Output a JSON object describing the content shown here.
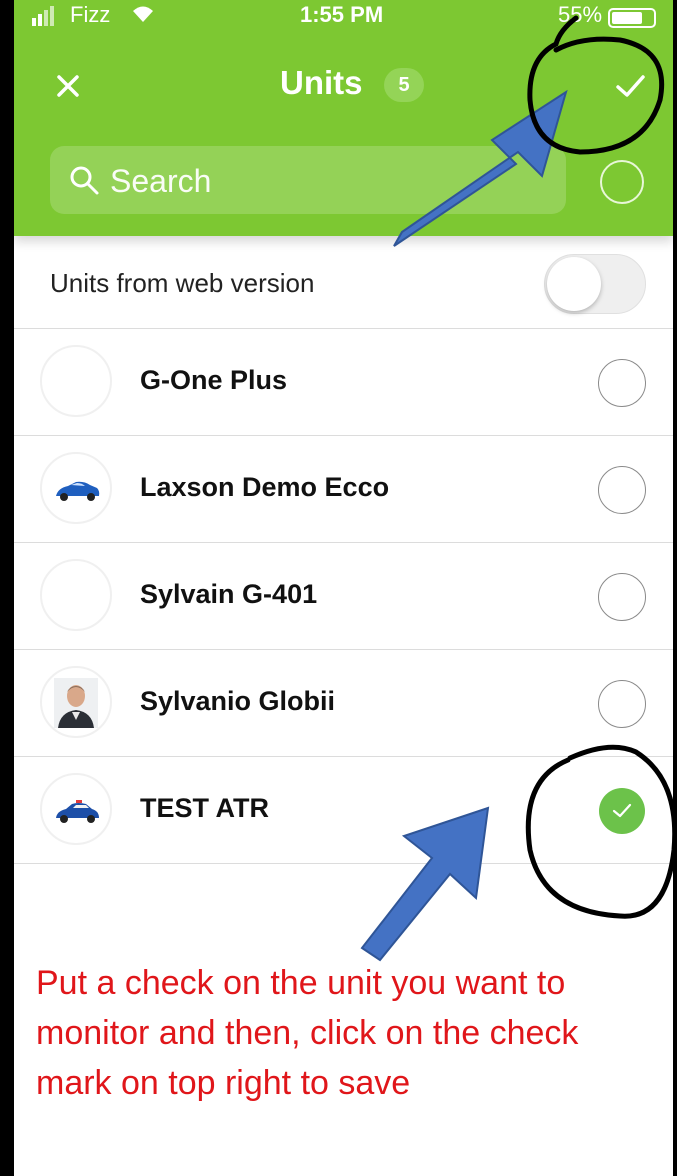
{
  "status_bar": {
    "carrier": "Fizz",
    "time": "1:55 PM",
    "battery_pct": "55%"
  },
  "header": {
    "title": "Units",
    "count": "5",
    "close_icon": "close-icon",
    "save_icon": "checkmark-icon",
    "accent_color": "#7dc832"
  },
  "search": {
    "placeholder": "Search",
    "value": ""
  },
  "web_units": {
    "label": "Units from web version",
    "enabled": false
  },
  "units": [
    {
      "name": "G-One Plus",
      "avatar": "blank",
      "checked": false
    },
    {
      "name": "Laxson Demo Ecco",
      "avatar": "blue-car-icon",
      "checked": false
    },
    {
      "name": "Sylvain G-401",
      "avatar": "blank",
      "checked": false
    },
    {
      "name": "Sylvanio Globii",
      "avatar": "person-photo",
      "checked": false
    },
    {
      "name": "TEST ATR",
      "avatar": "police-car-icon",
      "checked": true
    }
  ],
  "instruction": "Put a check on the unit you want to monitor and then, click on the check mark on top right to save",
  "colors": {
    "instruction": "#e0161a",
    "checked": "#6cc24a",
    "arrow": "#4472c4"
  }
}
